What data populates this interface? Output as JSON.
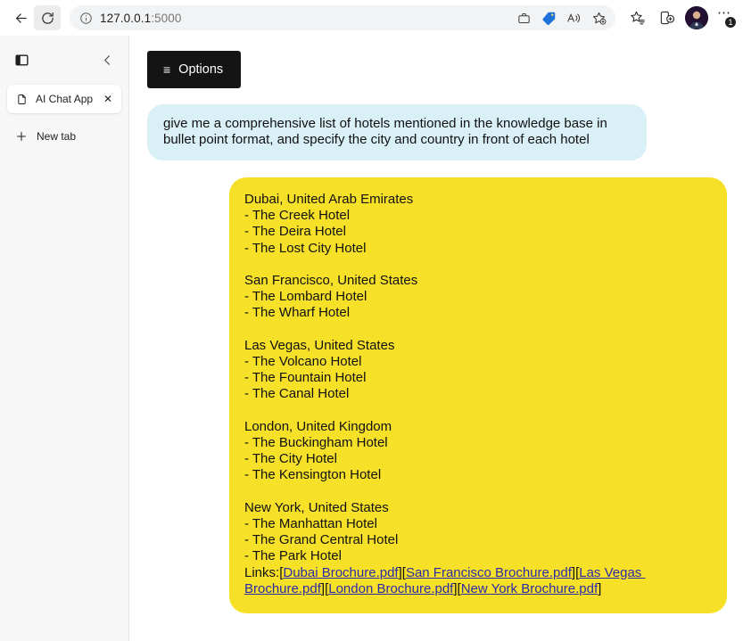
{
  "browser": {
    "back_label": "Back",
    "reload_label": "Refresh",
    "url": "127.0.0.1",
    "url_port": ":5000",
    "url_full": "127.0.0.1:5000",
    "icons": {
      "info": "info-icon",
      "collections": "briefcase-icon",
      "shopping_tag": "shopping-tag-icon",
      "read_aloud": "read-aloud-icon",
      "add_favorite": "add-favorite-star-icon",
      "favorites": "favorites-list-icon",
      "split_screen": "split-screen-icon",
      "profile": "profile-avatar",
      "settings_more": "more-options-icon"
    },
    "more_badge": "1"
  },
  "sidebar": {
    "panel_icon": "sidebar-panel-icon",
    "collapse_icon": "chevron-left-icon",
    "tabs": [
      {
        "title": "AI Chat App",
        "favicon": "page-icon",
        "close": "✕"
      }
    ],
    "new_tab_label": "New tab",
    "new_tab_plus": "+"
  },
  "page": {
    "options_button": "Options",
    "hamburger_icon": "≡",
    "conversation": {
      "user_message": "give me a comprehensive list of hotels mentioned in the knowledge base in bullet point format, and specify the city and country in front of each hotel",
      "assistant_groups": [
        {
          "location": "Dubai, United Arab Emirates",
          "hotels": [
            "- The Creek Hotel",
            "- The Deira Hotel",
            "- The Lost City Hotel"
          ]
        },
        {
          "location": "San Francisco, United States",
          "hotels": [
            "- The Lombard Hotel",
            "- The Wharf Hotel"
          ]
        },
        {
          "location": "Las Vegas, United States",
          "hotels": [
            "- The Volcano Hotel",
            "- The Fountain Hotel",
            "- The Canal Hotel"
          ]
        },
        {
          "location": "London, United Kingdom",
          "hotels": [
            "- The Buckingham Hotel",
            "- The City Hotel",
            "- The Kensington Hotel"
          ]
        },
        {
          "location": "New York, United States",
          "hotels": [
            "- The Manhattan Hotel",
            "- The Grand Central Hotel",
            "- The Park Hotel"
          ]
        }
      ],
      "links_label": "Links:",
      "links": [
        "Dubai Brochure.pdf",
        "San Francisco Brochure.pdf",
        "Las Vegas Brochure.pdf",
        "London Brochure.pdf",
        "New York Brochure.pdf"
      ]
    }
  },
  "colors": {
    "user_bubble": "#d9f0f6",
    "assistant_bubble": "#f7e028",
    "options_button": "#141414",
    "link": "#2b2ba8",
    "sidebar_bg": "#f7f7f7"
  }
}
